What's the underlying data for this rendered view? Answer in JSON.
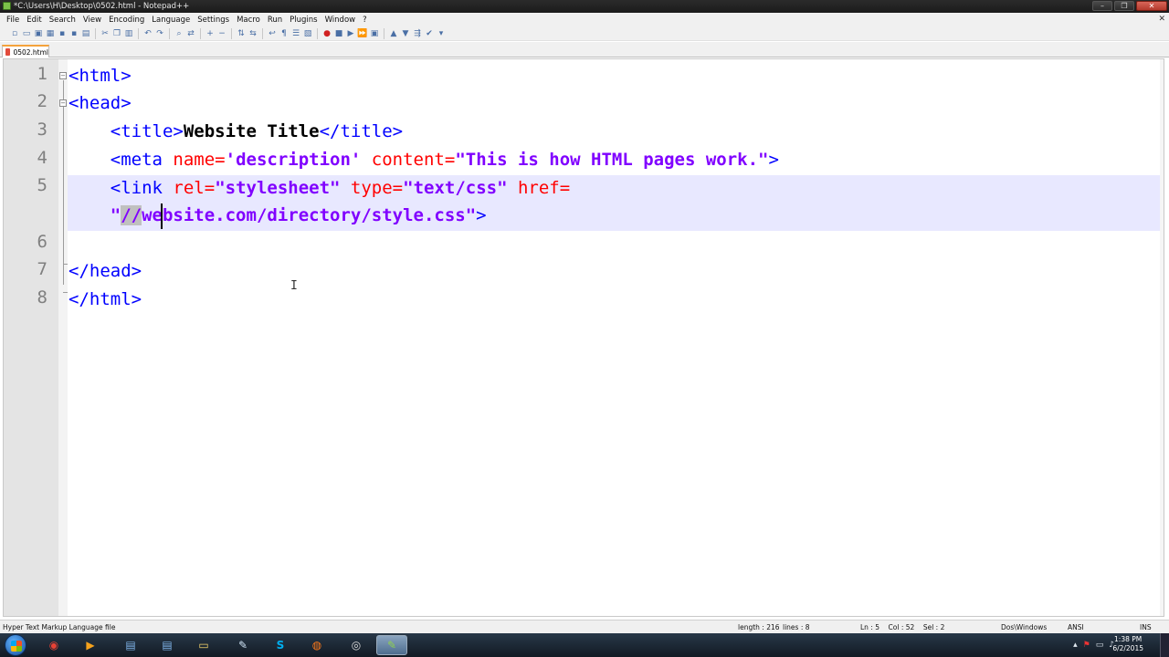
{
  "window": {
    "title": "*C:\\Users\\H\\Desktop\\0502.html - Notepad++",
    "minimize_glyph": "–",
    "maximize_glyph": "❐",
    "close_glyph": "✕"
  },
  "menu": {
    "items": [
      "File",
      "Edit",
      "Search",
      "View",
      "Encoding",
      "Language",
      "Settings",
      "Macro",
      "Run",
      "Plugins",
      "Window",
      "?"
    ],
    "close_glyph": "✕"
  },
  "tabs": [
    {
      "label": "0502.html",
      "active": true,
      "modified": true
    }
  ],
  "editor": {
    "line_numbers": [
      "1",
      "2",
      "3",
      "4",
      "5",
      "",
      "6",
      "7",
      "8"
    ],
    "current_line": 5,
    "lines": {
      "l1": {
        "open": "<html>"
      },
      "l2": {
        "open": "<head>"
      },
      "l3": {
        "indent": "    ",
        "open": "<title>",
        "text": "Website Title",
        "close": "</title>"
      },
      "l4": {
        "indent": "    ",
        "tag_open": "<meta",
        "sp1": " ",
        "attr1": "name=",
        "val1": "'description'",
        "sp2": " ",
        "attr2": "content=",
        "val2": "\"This is how HTML pages work.\"",
        "tag_close": ">"
      },
      "l5": {
        "indent": "    ",
        "tag_open": "<link",
        "sp1": " ",
        "attr1": "rel=",
        "val1": "\"stylesheet\"",
        "sp2": " ",
        "attr2": "type=",
        "val2": "\"text/css\"",
        "sp3": " ",
        "attr3": "href="
      },
      "l5b": {
        "indent": "    ",
        "val_quote": "\"",
        "val_sel": "//",
        "val_rest": "website.com/directory/style.css\"",
        "tag_close": ">"
      },
      "l7": {
        "open": "</head>"
      },
      "l8": {
        "open": "</html>"
      }
    }
  },
  "status": {
    "file_type": "Hyper Text Markup Language file",
    "length": "length : 216",
    "lines": "lines : 8",
    "position": "Ln : 5    Col : 52    Sel : 2",
    "eol": "Dos\\Windows",
    "encoding": "ANSI",
    "mode": "INS"
  },
  "taskbar": {
    "apps": [
      {
        "name": "chrome",
        "glyph": "◉",
        "color": "#e94235"
      },
      {
        "name": "media-player",
        "glyph": "▶",
        "color": "#f6a21c"
      },
      {
        "name": "documents",
        "glyph": "▤",
        "color": "#7fb3e8"
      },
      {
        "name": "documents-2",
        "glyph": "▤",
        "color": "#7fb3e8"
      },
      {
        "name": "file-explorer",
        "glyph": "▭",
        "color": "#f3d36b"
      },
      {
        "name": "pen-tool",
        "glyph": "✎",
        "color": "#cfe3f5"
      },
      {
        "name": "skype",
        "glyph": "S",
        "color": "#00aff0"
      },
      {
        "name": "firefox",
        "glyph": "◍",
        "color": "#ff7a1a"
      },
      {
        "name": "camera",
        "glyph": "◎",
        "color": "#dddddd"
      },
      {
        "name": "notepad-plus-plus",
        "glyph": "✎",
        "color": "#8fd14f"
      }
    ],
    "time": "1:38 PM",
    "date": "6/2/2015"
  },
  "colors": {
    "tag": "#0000ff",
    "attribute": "#ff0000",
    "value": "#8000ff",
    "current_line": "#e8e8ff",
    "gutter": "#e4e4e4"
  }
}
